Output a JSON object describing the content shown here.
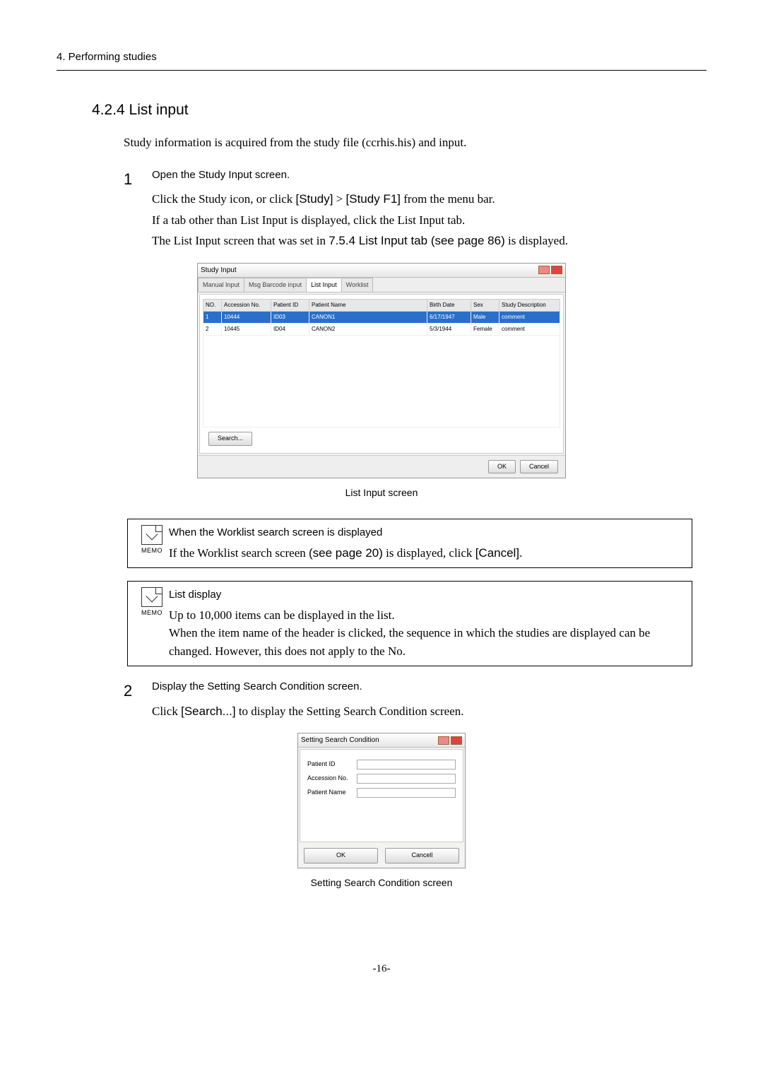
{
  "header": "4. Performing studies",
  "section_title": "4.2.4 List input",
  "intro": "Study information is acquired from the study file (ccrhis.his) and input.",
  "steps": [
    {
      "num": "1",
      "heading": "Open the Study Input screen.",
      "lines": [
        {
          "pre": "Click the Study icon, or click ",
          "b1": "[Study]",
          "mid": " > ",
          "b2": "[Study F1]",
          "post": " from the menu bar."
        },
        {
          "pre": "If a tab other than List Input is displayed, click the List Input tab."
        },
        {
          "pre": "The List Input screen that was set in ",
          "b1": "7.5.4 List Input tab (see page 86)",
          "post": " is displayed."
        }
      ]
    },
    {
      "num": "2",
      "heading": "Display the Setting Search Condition screen.",
      "lines": [
        {
          "pre": "Click ",
          "b1": "[Search...]",
          "post": " to display the Setting Search Condition screen."
        }
      ]
    }
  ],
  "caption1": "List Input screen",
  "caption2": "Setting Search Condition screen",
  "memo_label": "MEMO",
  "memo1": {
    "title": "When the Worklist search screen is displayed",
    "text_pre": "If the Worklist search screen ",
    "text_b1": "(see page 20)",
    "text_mid": " is displayed, click ",
    "text_b2": "[Cancel]",
    "text_post": "."
  },
  "memo2": {
    "title": "List display",
    "line1": "Up to 10,000 items can be displayed in the list.",
    "line2": "When the item name of the header is clicked, the sequence in which the studies are displayed can be changed. However, this does not apply to the No."
  },
  "dlg": {
    "title": "Study Input",
    "tabs": [
      "Manual Input",
      "Msg Barcode input",
      "List Input",
      "Worklist"
    ],
    "headers": [
      "NO.",
      "Accession No.",
      "Patient ID",
      "Patient Name",
      "Birth Date",
      "Sex",
      "Study Description"
    ],
    "rows": [
      {
        "no": "1",
        "acc": "10444",
        "pid": "ID03",
        "name": "CANON1",
        "bd": "6/17/1947",
        "sex": "Male",
        "desc": "comment"
      },
      {
        "no": "2",
        "acc": "10445",
        "pid": "ID04",
        "name": "CANON2",
        "bd": "5/3/1944",
        "sex": "Female",
        "desc": "comment"
      }
    ],
    "search": "Search...",
    "ok": "OK",
    "cancel": "Cancel"
  },
  "dlg2": {
    "title": "Setting Search Condition",
    "fields": [
      "Patient ID",
      "Accession No.",
      "Patient Name"
    ],
    "ok": "OK",
    "cancel": "Cancell"
  },
  "page_num": "-16-"
}
